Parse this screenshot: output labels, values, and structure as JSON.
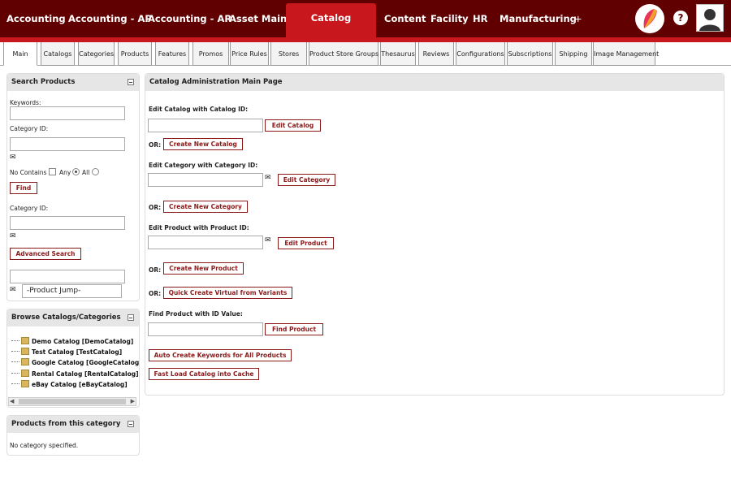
{
  "topnav": {
    "tabs": [
      "Accounting",
      "Accounting - AP",
      "Accounting - AR",
      "Asset Maint",
      "Catalog",
      "Content",
      "Facility",
      "HR",
      "Manufacturing"
    ],
    "active": "Catalog",
    "plus": "+",
    "help": "?"
  },
  "subtabs": [
    "Main",
    "Catalogs",
    "Categories",
    "Products",
    "Features",
    "Promos",
    "Price Rules",
    "Stores",
    "Product Store Groups",
    "Thesaurus",
    "Reviews",
    "Configurations",
    "Subscriptions",
    "Shipping",
    "Image Management"
  ],
  "search": {
    "title": "Search Products",
    "keywords_label": "Keywords:",
    "category_label": "Category ID:",
    "no_contains": "No Contains",
    "any": "Any",
    "all": "All",
    "find": "Find",
    "category_label2": "Category ID:",
    "advanced": "Advanced Search",
    "jump_value": "-Product Jump-"
  },
  "browse": {
    "title": "Browse Catalogs/Categories",
    "items": [
      "Demo Catalog [DemoCatalog]",
      "Test Catalog [TestCatalog]",
      "Google Catalog [GoogleCatalog",
      "Rental Catalog [RentalCatalog]",
      "eBay Catalog [eBayCatalog]"
    ]
  },
  "products_cat": {
    "title": "Products from this category",
    "empty": "No category specified."
  },
  "main": {
    "title": "Catalog Administration Main Page",
    "edit_catalog_label": "Edit Catalog with Catalog ID:",
    "edit_catalog_btn": "Edit Catalog",
    "or": "OR:",
    "create_catalog_btn": "Create New Catalog",
    "edit_category_label": "Edit Category with Category ID:",
    "edit_category_btn": "Edit Category",
    "create_category_btn": "Create New Category",
    "edit_product_label": "Edit Product with Product ID:",
    "edit_product_btn": "Edit Product",
    "create_product_btn": "Create New Product",
    "quick_virtual_btn": "Quick Create Virtual from Variants",
    "find_product_label": "Find Product with ID Value:",
    "find_product_btn": "Find Product",
    "auto_keywords_btn": "Auto Create Keywords for All Products",
    "fast_load_btn": "Fast Load Catalog into Cache"
  },
  "colors": {
    "topbar": "#600000",
    "accent": "#c8181e",
    "button": "#8b1a1a"
  }
}
